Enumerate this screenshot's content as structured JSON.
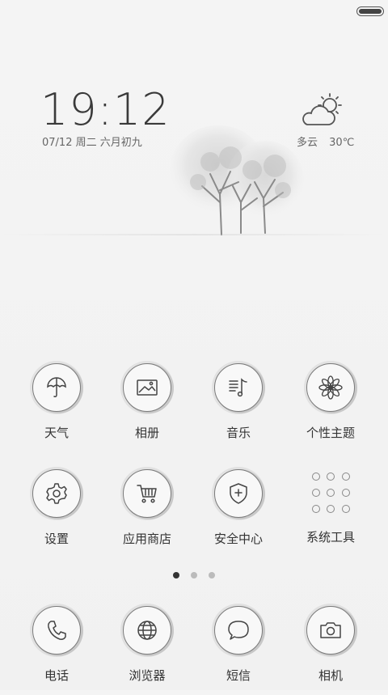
{
  "status_bar": {
    "battery_level": 1.0
  },
  "clock": {
    "time": "19:12",
    "date": "07/12 周二 六月初九"
  },
  "weather": {
    "condition": "多云",
    "temperature": "30℃",
    "icon": "partly-cloudy-icon"
  },
  "apps_page": [
    [
      {
        "label": "天气",
        "icon": "umbrella-icon"
      },
      {
        "label": "相册",
        "icon": "gallery-icon"
      },
      {
        "label": "音乐",
        "icon": "music-icon"
      },
      {
        "label": "个性主题",
        "icon": "flower-icon"
      }
    ],
    [
      {
        "label": "设置",
        "icon": "gear-icon"
      },
      {
        "label": "应用商店",
        "icon": "cart-icon"
      },
      {
        "label": "安全中心",
        "icon": "shield-icon"
      },
      {
        "label": "系统工具",
        "icon": "folder-grid-icon"
      }
    ]
  ],
  "page_indicator": {
    "count": 3,
    "active": 0
  },
  "dock": [
    {
      "label": "电话",
      "icon": "phone-icon"
    },
    {
      "label": "浏览器",
      "icon": "globe-icon"
    },
    {
      "label": "短信",
      "icon": "message-icon"
    },
    {
      "label": "相机",
      "icon": "camera-icon"
    }
  ]
}
